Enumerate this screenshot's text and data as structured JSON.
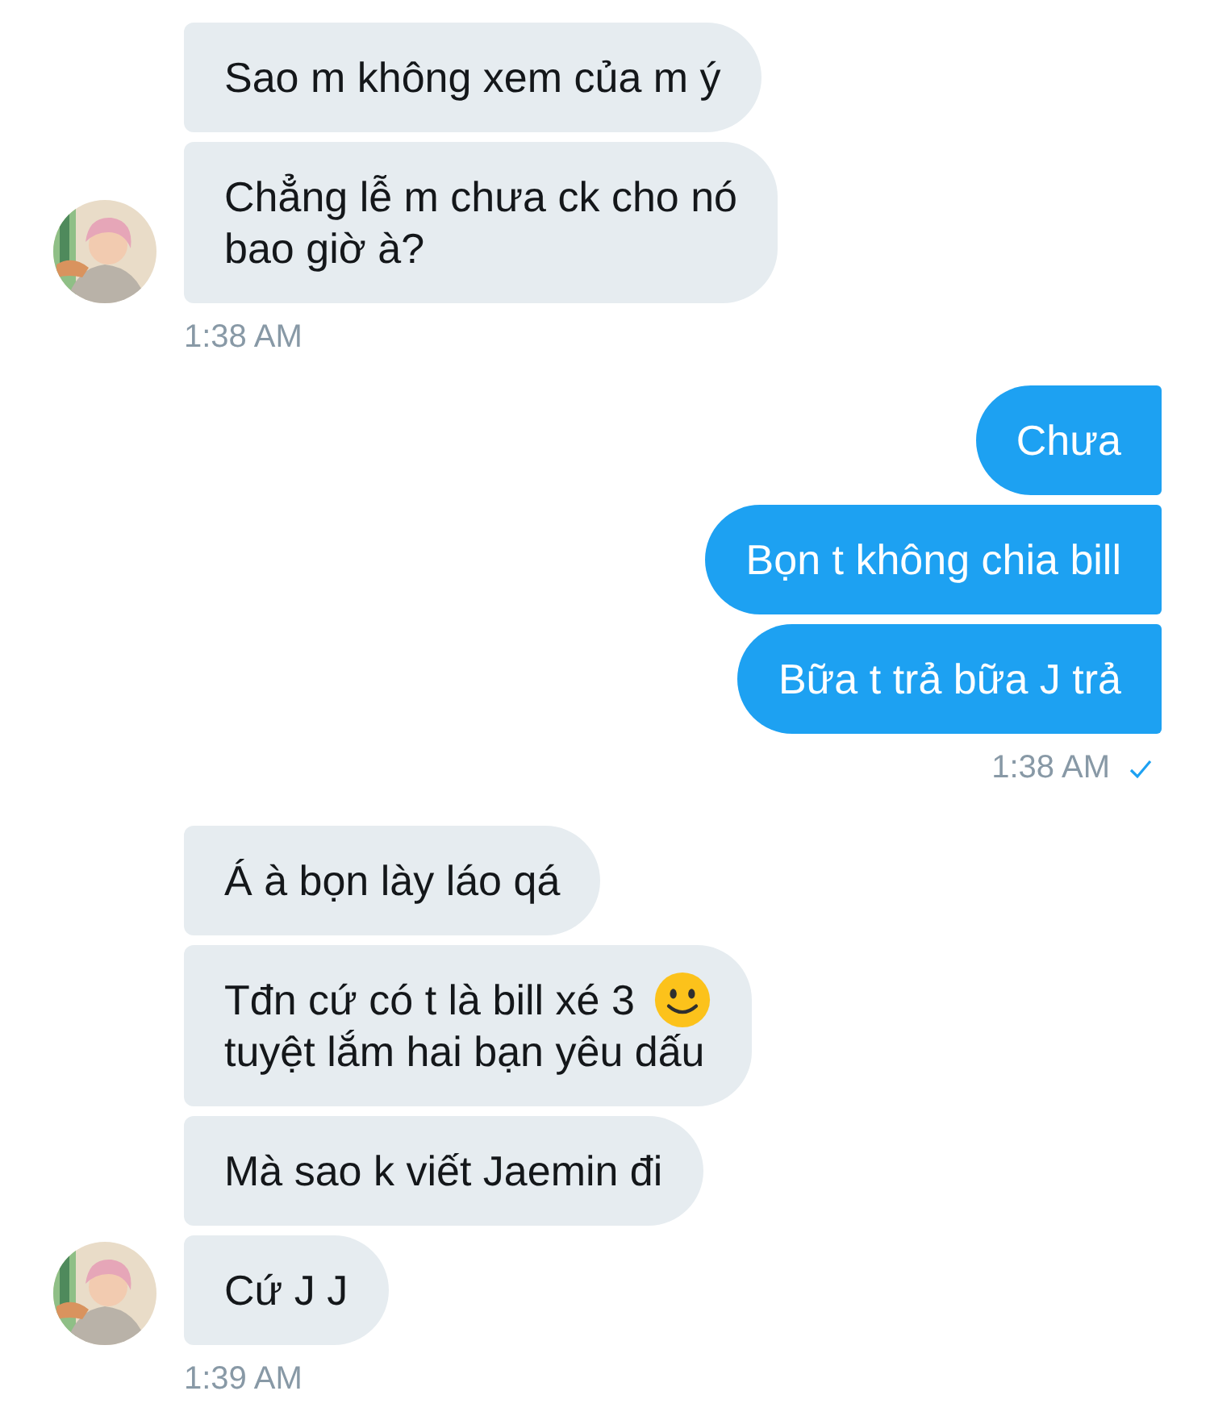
{
  "groups": [
    {
      "kind": "incoming",
      "time": "1:38 AM",
      "messages": [
        {
          "kind": "plain",
          "lines": [
            "Sao m không xem của m ý"
          ]
        },
        {
          "kind": "plain",
          "lines": [
            "Chẳng lễ m chưa ck cho nó",
            "bao giờ à?"
          ]
        }
      ]
    },
    {
      "kind": "outgoing",
      "time": "1:38 AM",
      "read": true,
      "messages": [
        {
          "kind": "plain",
          "lines": [
            "Chưa"
          ]
        },
        {
          "kind": "plain",
          "lines": [
            "Bọn t không chia bill"
          ]
        },
        {
          "kind": "plain",
          "lines": [
            "Bữa t trả bữa J trả"
          ]
        }
      ]
    },
    {
      "kind": "incoming",
      "time": "1:39 AM",
      "messages": [
        {
          "kind": "plain",
          "lines": [
            "Á à bọn lày láo qá"
          ]
        },
        {
          "kind": "smiley",
          "lines": [
            "Tđn cứ có t là bill xé 3",
            "tuyệt lắm hai bạn yêu dấu"
          ]
        },
        {
          "kind": "plain",
          "lines": [
            "Mà sao k viết Jaemin đi"
          ]
        },
        {
          "kind": "plain",
          "lines": [
            "Cứ J J"
          ]
        }
      ]
    }
  ]
}
